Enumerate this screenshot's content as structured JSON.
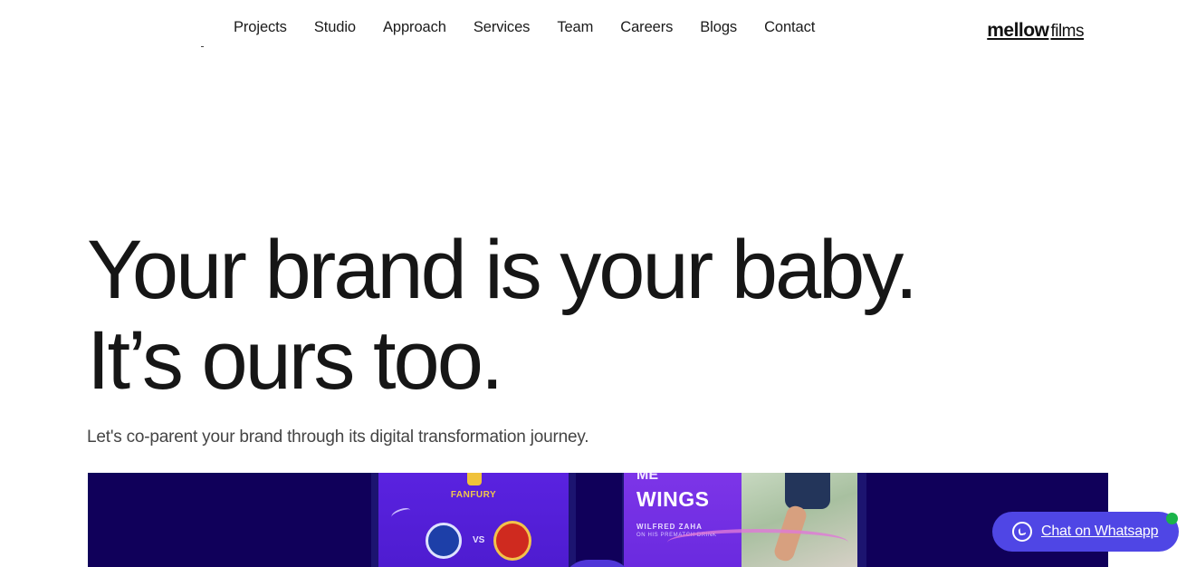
{
  "nav": {
    "items": [
      {
        "label": "Projects"
      },
      {
        "label": "Studio"
      },
      {
        "label": "Approach"
      },
      {
        "label": "Services"
      },
      {
        "label": "Team"
      },
      {
        "label": "Careers"
      },
      {
        "label": "Blogs"
      },
      {
        "label": "Contact"
      }
    ]
  },
  "logo": {
    "bold": "mellow",
    "light": "films"
  },
  "hero": {
    "line1": "Your brand is your baby.",
    "line2": "It’s ours too.",
    "subtitle": "Let's co-parent your brand through its digital transformation journey."
  },
  "banner": {
    "phone1": {
      "brand": "FANFURY",
      "vs": "VS"
    },
    "phone2": {
      "top": "ME",
      "title": "WINGS",
      "sub1": "WILFRED ZAHA",
      "sub2": "ON HIS PREMATCH DRINK"
    }
  },
  "whatsapp": {
    "label": "Chat on Whatsapp",
    "color": "#4f46e5",
    "status_color": "#1ab44a",
    "icon": "whatsapp-icon"
  }
}
